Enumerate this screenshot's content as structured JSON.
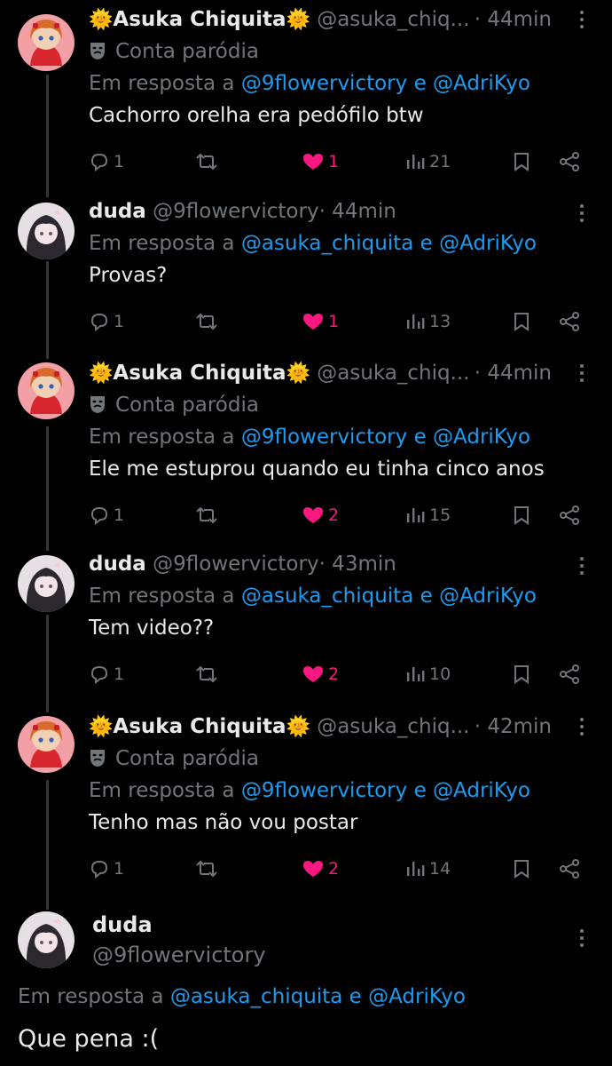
{
  "tweets": [
    {
      "author": "Asuka Chiquita",
      "handle": "@asuka_chiq...",
      "time": "· 44min",
      "badge": "Conta paródia",
      "reply_prefix": "Em resposta a",
      "reply_to_1": "@9flowervictory",
      "reply_join": "e",
      "reply_to_2": "@AdriKyo",
      "text": "Cachorro orelha era pedófilo btw",
      "replies": "1",
      "likes": "1",
      "views": "21"
    },
    {
      "author": "duda",
      "handle": "@9flowervictory",
      "time": "· 44min",
      "reply_prefix": "Em resposta a",
      "reply_to_1": "@asuka_chiquita",
      "reply_join": "e",
      "reply_to_2": "@AdriKyo",
      "text": "Provas?",
      "replies": "1",
      "likes": "1",
      "views": "13"
    },
    {
      "author": "Asuka Chiquita",
      "handle": "@asuka_chiq...",
      "time": "· 44min",
      "badge": "Conta paródia",
      "reply_prefix": "Em resposta a",
      "reply_to_1": "@9flowervictory",
      "reply_join": "e",
      "reply_to_2": "@AdriKyo",
      "text": "Ele me estuprou quando eu tinha cinco anos",
      "replies": "1",
      "likes": "2",
      "views": "15"
    },
    {
      "author": "duda",
      "handle": "@9flowervictory",
      "time": "· 43min",
      "reply_prefix": "Em resposta a",
      "reply_to_1": "@asuka_chiquita",
      "reply_join": "e",
      "reply_to_2": "@AdriKyo",
      "text": "Tem video??",
      "replies": "1",
      "likes": "2",
      "views": "10"
    },
    {
      "author": "Asuka Chiquita",
      "handle": "@asuka_chiq...",
      "time": "· 42min",
      "badge": "Conta paródia",
      "reply_prefix": "Em resposta a",
      "reply_to_1": "@9flowervictory",
      "reply_join": "e",
      "reply_to_2": "@AdriKyo",
      "text": "Tenho mas não vou postar",
      "replies": "1",
      "likes": "2",
      "views": "14"
    }
  ],
  "focused": {
    "author": "duda",
    "handle": "@9flowervictory",
    "reply_prefix": "Em resposta a",
    "reply_to_1": "@asuka_chiquita",
    "reply_join": "e",
    "reply_to_2": "@AdriKyo",
    "text": "Que pena :("
  },
  "colors": {
    "background": "#000000",
    "link": "#1d9bf0",
    "like": "#f91880",
    "muted": "#71767b",
    "text": "#e7e9ea"
  },
  "icons": {
    "reply": "reply-icon",
    "retweet": "retweet-icon",
    "like": "heart-filled-icon",
    "views": "views-icon",
    "bookmark": "bookmark-icon",
    "share": "share-icon",
    "more": "more-dots-icon",
    "parody": "parody-mask-icon",
    "emoji": "sun-emoji"
  }
}
